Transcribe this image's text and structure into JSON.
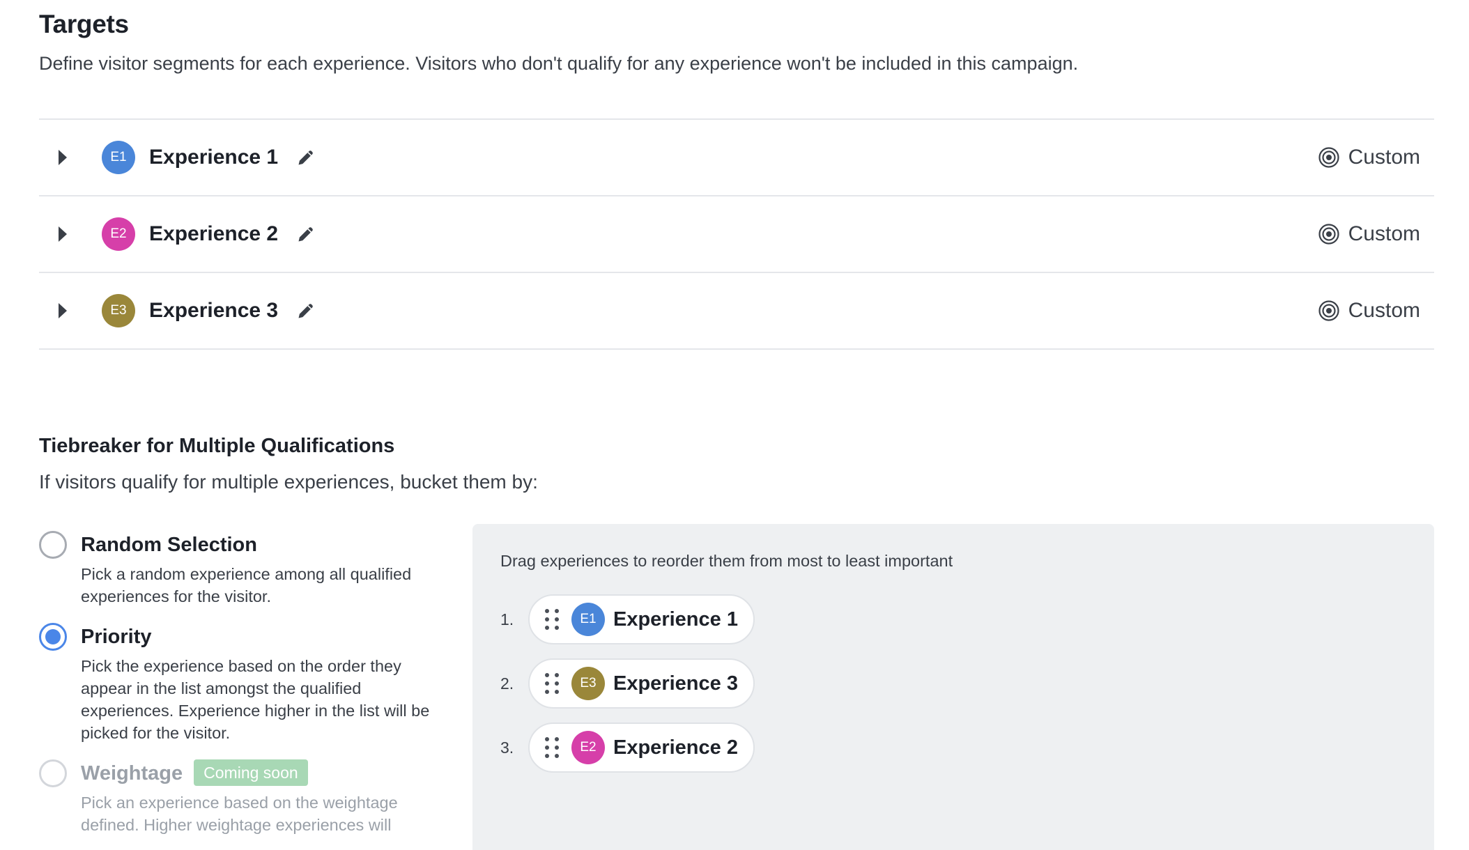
{
  "targets": {
    "title": "Targets",
    "description": "Define visitor segments for each experience. Visitors who don't qualify for any experience won't be included in this campaign.",
    "experiences": [
      {
        "badge": "E1",
        "name": "Experience 1",
        "target": "Custom",
        "color": "#4a86d9"
      },
      {
        "badge": "E2",
        "name": "Experience 2",
        "target": "Custom",
        "color": "#d63fa9"
      },
      {
        "badge": "E3",
        "name": "Experience 3",
        "target": "Custom",
        "color": "#9a873a"
      }
    ]
  },
  "tiebreaker": {
    "title": "Tiebreaker for Multiple Qualifications",
    "description": "If visitors qualify for multiple experiences, bucket them by:",
    "options": [
      {
        "label": "Random Selection",
        "description": "Pick a random experience among all qualified experiences for the visitor.",
        "selected": false,
        "disabled": false
      },
      {
        "label": "Priority",
        "description": "Pick the experience based on the order they appear in the list amongst the qualified experiences. Experience higher in the list will be picked for the visitor.",
        "selected": true,
        "disabled": false
      },
      {
        "label": "Weightage",
        "badge": "Coming soon",
        "description": "Pick an experience based on the weightage defined. Higher weightage experiences will",
        "selected": false,
        "disabled": true
      }
    ],
    "priority_panel": {
      "hint": "Drag experiences to reorder them from most to least important",
      "items": [
        {
          "num": "1.",
          "badge": "E1",
          "name": "Experience 1",
          "color": "#4a86d9"
        },
        {
          "num": "2.",
          "badge": "E3",
          "name": "Experience 3",
          "color": "#9a873a"
        },
        {
          "num": "3.",
          "badge": "E2",
          "name": "Experience 2",
          "color": "#d63fa9"
        }
      ]
    }
  },
  "colors": {
    "accent": "#4a86e8",
    "coming_soon": "#a8d8b5"
  }
}
